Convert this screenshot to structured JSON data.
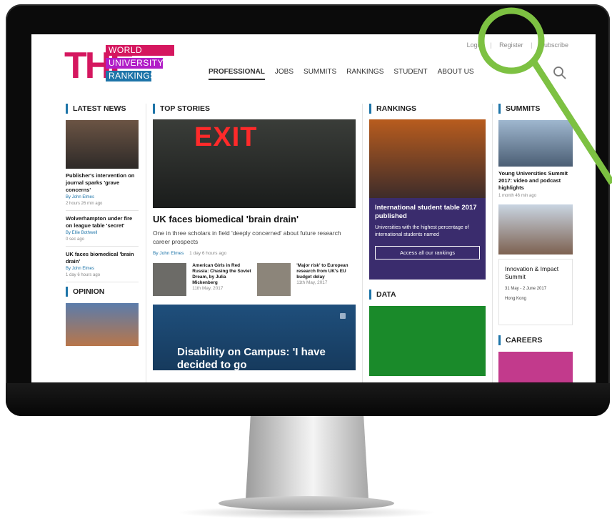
{
  "site": {
    "logo": {
      "letters": "THE",
      "line1": "WORLD",
      "line2": "UNIVERSITY",
      "line3": "RANKINGS"
    },
    "top_links": [
      "Login",
      "Register",
      "Subscribe"
    ],
    "nav": [
      "PROFESSIONAL",
      "JOBS",
      "SUMMITS",
      "RANKINGS",
      "STUDENT",
      "ABOUT US"
    ],
    "nav_active": "PROFESSIONAL"
  },
  "columns": {
    "latest": {
      "title": "LATEST NEWS",
      "items": [
        {
          "headline": "Publisher's intervention on journal sparks 'grave concerns'",
          "byline": "By John Elmes",
          "time": "2 hours 26 min ago"
        },
        {
          "headline": "Wolverhampton under fire on league table 'secret'",
          "byline": "By Ellie Bothwell",
          "time": "0 sec ago"
        },
        {
          "headline": "UK faces biomedical 'brain drain'",
          "byline": "By John Elmes",
          "time": "1 day 6 hours ago"
        }
      ],
      "opinion_title": "OPINION"
    },
    "top": {
      "title": "TOP STORIES",
      "exit_sign": "EXIT",
      "headline": "UK faces biomedical 'brain drain'",
      "summary": "One in three scholars in field 'deeply concerned' about future research career prospects",
      "byline": "By John Elmes",
      "time": "1 day 6 hours ago",
      "small": [
        {
          "headline": "American Girls in Red Russia: Chasing the Soviet Dream, by Julia Mickenberg",
          "date": "11th May, 2017"
        },
        {
          "headline": "'Major risk' to European research from UK's EU budget delay",
          "date": "11th May, 2017"
        }
      ],
      "feature": "Disability on Campus: 'I have decided to go"
    },
    "rankings": {
      "title": "RANKINGS",
      "headline": "International student table 2017 published",
      "text": "Universities with the highest percentage of international students named",
      "button": "Access all our rankings",
      "data_title": "DATA"
    },
    "summits": {
      "title": "SUMMITS",
      "headline": "Young Universities Summit 2017: video and podcast highlights",
      "time": "1 month 46 min ago",
      "event": "Innovation & Impact Summit",
      "dates": "31 May - 2 June 2017",
      "location": "Hong Kong",
      "careers_title": "CAREERS"
    }
  },
  "colors": {
    "logo_pink": "#d5175f",
    "logo_purple": "#b11ec7",
    "logo_blue": "#1d74a8",
    "rankings_box": "#3a2c6d",
    "highlight_ring": "#7dc142"
  }
}
